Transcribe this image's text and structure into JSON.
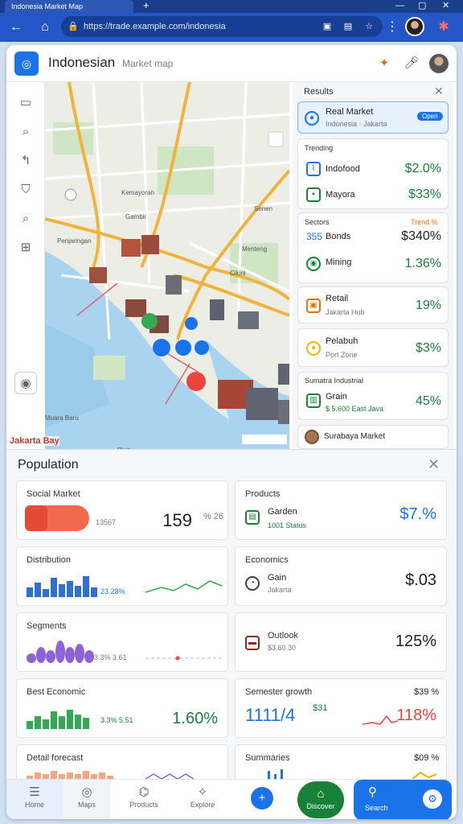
{
  "browser": {
    "tab_title": "Indonesia Market Map",
    "new_tab": "+",
    "url": "https://trade.example.com/indonesia",
    "controls": [
      "—",
      "▢",
      "✕"
    ]
  },
  "app": {
    "title": "Indonesian",
    "subtitle": "Market map"
  },
  "right_panel": {
    "title": "Results",
    "highlight": {
      "title": "Real Market",
      "sub": "Indonesia · Jakarta",
      "badge": "Open"
    },
    "group1_label": "Trending",
    "group1": [
      {
        "label": "Indofood",
        "value": "$2.0%",
        "color": "#188038"
      },
      {
        "label": "Mayora",
        "value": "$33%",
        "color": "#188038"
      }
    ],
    "group2_label": "Sectors",
    "group2_tag": "Trend %",
    "group2": [
      {
        "label": "Bonds",
        "icon_text": "355",
        "value": "$340%",
        "color": "#222"
      },
      {
        "label": "Mining",
        "value": "1.36%",
        "color": "#188038"
      }
    ],
    "card_a": {
      "label": "Retail",
      "sub": "Jakarta Hub",
      "value": "19%"
    },
    "card_b": {
      "label": "Pelabuh",
      "sub": "Port Zone",
      "value": "$3%"
    },
    "card_c": {
      "label": "Sumatra Industrial",
      "sub2": "Grain",
      "sub3": "$ 5,600  East Java",
      "value": "45%"
    },
    "card_d": {
      "label": "Surabaya Market"
    }
  },
  "map": {
    "caption": "Jakarta Bay"
  },
  "sheet": {
    "title": "Population",
    "cards": [
      {
        "title": "Social Market",
        "sub": "13567",
        "value": "159",
        "unit": "% 26"
      },
      {
        "title": "Products",
        "sub": "Garden",
        "sub2": "1001  Status",
        "value": "$7.%"
      },
      {
        "title": "Distribution",
        "sub": "23.28%",
        "value": ""
      },
      {
        "title": "Economics",
        "sub": "Gain",
        "sub2": "Jakarta",
        "value": "$.03"
      },
      {
        "title": "Segments",
        "sub": "3.3%  3.61",
        "value": ""
      },
      {
        "title": "Outlook",
        "sub": "$3.60  30",
        "value": "125%"
      },
      {
        "title": "Best Economic",
        "sub": "3.3%  5.51",
        "value": "1.60%"
      },
      {
        "title": "Semester growth",
        "sub": "$31",
        "value": "118%",
        "top_value": "$39 %",
        "big": "1111/4"
      },
      {
        "title": "Detail forecast",
        "sub": "",
        "value": ""
      },
      {
        "title": "Summaries",
        "sub": "",
        "value": "",
        "top_value": "$09 %"
      }
    ]
  },
  "bottom_nav": [
    {
      "label": "Home",
      "icon": "menu-icon"
    },
    {
      "label": "Maps",
      "icon": "compass-icon"
    },
    {
      "label": "Products",
      "icon": "tag-icon"
    },
    {
      "label": "Explore",
      "icon": "spark-icon"
    },
    {
      "label": "",
      "icon": "add-icon"
    },
    {
      "label": "Discover",
      "icon": "house-icon"
    },
    {
      "label": "Search",
      "icon": "search-icon"
    },
    {
      "label": "",
      "icon": "settings-icon"
    }
  ],
  "colors": {
    "accent": "#1a73e8",
    "green": "#188038",
    "red": "#e8453c"
  }
}
